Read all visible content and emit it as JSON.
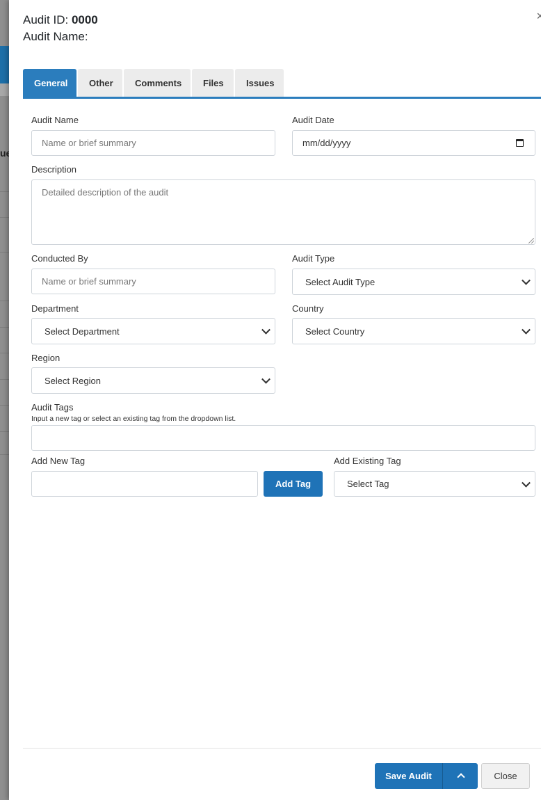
{
  "header": {
    "audit_id_label": "Audit ID:",
    "audit_id_value": "0000",
    "audit_name_label": "Audit Name:",
    "close_glyph": "×"
  },
  "tabs": [
    {
      "label": "General",
      "active": true
    },
    {
      "label": "Other"
    },
    {
      "label": "Comments"
    },
    {
      "label": "Files"
    },
    {
      "label": "Issues"
    }
  ],
  "form": {
    "audit_name": {
      "label": "Audit Name",
      "placeholder": "Name or brief summary",
      "value": ""
    },
    "audit_date": {
      "label": "Audit Date",
      "placeholder": "mm/dd/yyyy"
    },
    "description": {
      "label": "Description",
      "placeholder": "Detailed description of the audit",
      "value": ""
    },
    "conducted_by": {
      "label": "Conducted By",
      "placeholder": "Name or brief summary",
      "value": ""
    },
    "audit_type": {
      "label": "Audit Type",
      "selected": "Select Audit Type"
    },
    "department": {
      "label": "Department",
      "selected": "Select Department"
    },
    "country": {
      "label": "Country",
      "selected": "Select Country"
    },
    "region": {
      "label": "Region",
      "selected": "Select Region"
    },
    "audit_tags": {
      "label": "Audit Tags",
      "help": "Input a new tag or select an existing tag from the dropdown list.",
      "value": ""
    },
    "add_new_tag": {
      "label": "Add New Tag",
      "value": "",
      "button": "Add Tag"
    },
    "add_existing_tag": {
      "label": "Add Existing Tag",
      "selected": "Select Tag"
    }
  },
  "footer": {
    "save_label": "Save Audit",
    "close_label": "Close"
  },
  "background": {
    "partial_text": "ue"
  },
  "colors": {
    "accent": "#2b7dbd",
    "primary_button": "#1f73b7"
  }
}
